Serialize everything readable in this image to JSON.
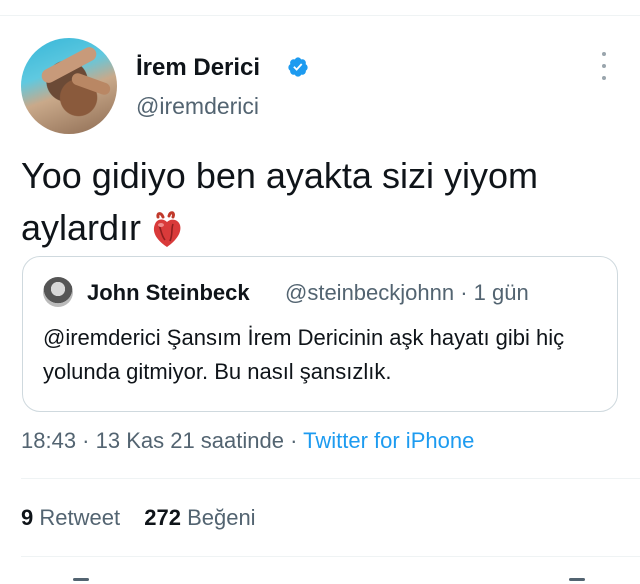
{
  "author": {
    "display_name": "İrem Derici",
    "handle": "@iremderici",
    "verified": true
  },
  "tweet": {
    "text": "Yoo gidiyo ben ayakta sizi yiyom aylardır",
    "emoji": "anatomical-heart-icon"
  },
  "quote": {
    "name": "John Steinbeck",
    "meta": "@steinbeckjohnn · 1 gün",
    "text": "@iremderici Şansım İrem Dericinin aşk hayatı gibi hiç yolunda gitmiyor. Bu nasıl şansızlık."
  },
  "timestamp": {
    "time_date": "18:43 · 13 Kas 21 saatinde · ",
    "source": "Twitter for iPhone"
  },
  "stats": {
    "retweets_count": "9",
    "retweets_label": "Retweet",
    "likes_count": "272",
    "likes_label": "Beğeni"
  },
  "colors": {
    "link": "#1d9bf0",
    "secondary_text": "#536471",
    "primary_text": "#0f1419"
  }
}
